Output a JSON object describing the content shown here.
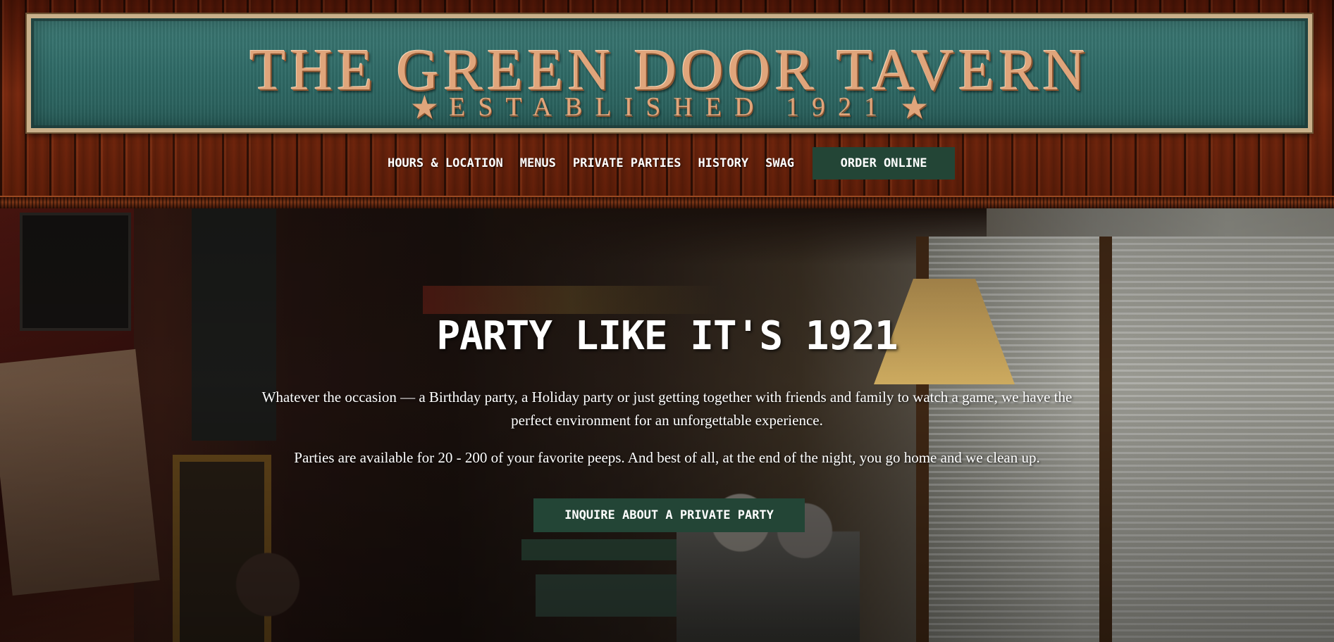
{
  "sign": {
    "title": "THE GREEN DOOR TAVERN",
    "subtitle": "ESTABLISHED 1921",
    "star": "★"
  },
  "nav": {
    "items": [
      {
        "label": "HOURS & LOCATION"
      },
      {
        "label": "MENUS"
      },
      {
        "label": "PRIVATE PARTIES"
      },
      {
        "label": "HISTORY"
      },
      {
        "label": "SWAG"
      }
    ],
    "order_label": "ORDER ONLINE"
  },
  "hero": {
    "title": "PARTY LIKE IT'S 1921",
    "paragraph1": "Whatever the occasion — a Birthday party, a Holiday party or just getting together with friends and family to watch a game, we have the perfect environment for an unforgettable experience.",
    "paragraph2": "Parties are available for 20 - 200 of your favorite peeps. And best of all, at the end of the night, you go home and we clean up.",
    "cta_label": "INQUIRE ABOUT A PRIVATE PARTY"
  },
  "colors": {
    "button_green": "#234536",
    "sign_teal": "#2f6a66",
    "sign_letter_copper": "#e0a57b"
  }
}
